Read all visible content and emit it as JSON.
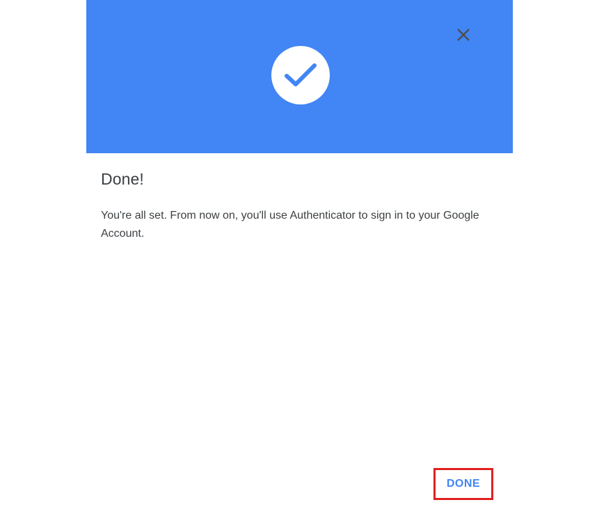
{
  "dialog": {
    "title": "Done!",
    "message": "You're all set. From now on, you'll use Authenticator to sign in to your Google Account.",
    "hero_icon": "check-icon",
    "close_icon": "close-icon",
    "done_label": "DONE"
  },
  "colors": {
    "hero_background": "#4285f4",
    "accent": "#4285f4",
    "highlight_border": "#e02020",
    "text": "#3c4043"
  }
}
